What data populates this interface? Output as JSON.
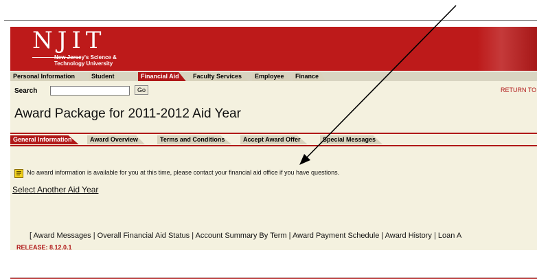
{
  "banner": {
    "logo_text": "NJIT",
    "logo_sub_line1": "New Jersey's Science &",
    "logo_sub_line2": "Technology University"
  },
  "main_tabs": [
    {
      "label": "Personal Information",
      "active": false
    },
    {
      "label": "Student",
      "active": false
    },
    {
      "label": "Financial Aid",
      "active": true
    },
    {
      "label": "Faculty Services",
      "active": false
    },
    {
      "label": "Employee",
      "active": false
    },
    {
      "label": "Finance",
      "active": false
    }
  ],
  "search": {
    "label": "Search",
    "value": "",
    "go_label": "Go"
  },
  "return_link": "RETURN TO",
  "page_title": "Award Package for 2011-2012 Aid Year",
  "sub_tabs": [
    {
      "label": "General Information",
      "active": true
    },
    {
      "label": "Award Overview",
      "active": false
    },
    {
      "label": "Terms and Conditions",
      "active": false
    },
    {
      "label": "Accept Award Offer",
      "active": false
    },
    {
      "label": "Special Messages",
      "active": false
    }
  ],
  "info_message": "No award information is available for you at this time, please contact your financial aid office if you have questions.",
  "select_link": "Select Another Aid Year",
  "footer_links": "[ Award Messages | Overall Financial Aid Status | Account Summary By Term | Award Payment Schedule | Award History | Loan A",
  "release": "RELEASE: 8.12.0.1",
  "colors": {
    "brand_red": "#b01818",
    "banner_red": "#bd1a1a",
    "content_bg": "#f4f1df",
    "tab_bg": "#d8d3bd"
  }
}
